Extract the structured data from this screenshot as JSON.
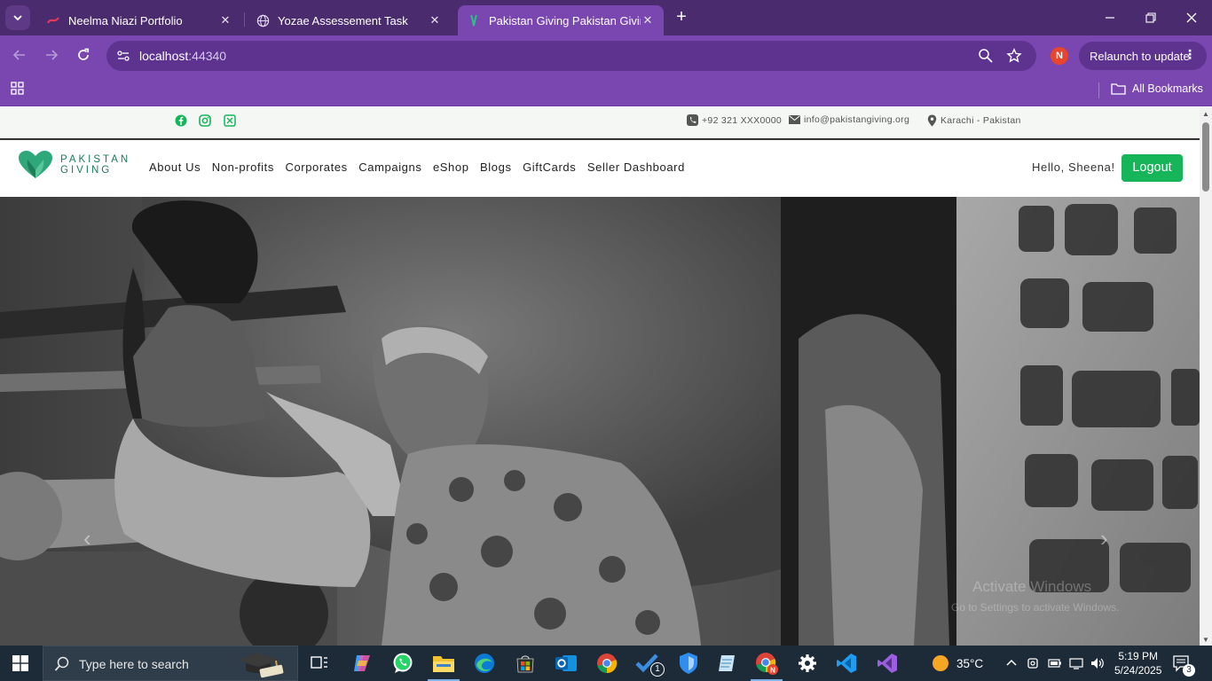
{
  "browser": {
    "tabs": [
      {
        "title": "Neelma Niazi Portfolio",
        "active": false
      },
      {
        "title": "Yozae Assessement Task",
        "active": false
      },
      {
        "title": "Pakistan Giving Pakistan Giving",
        "active": true
      }
    ],
    "url_host": "localhost",
    "url_port": ":44340",
    "profile_initial": "N",
    "relaunch_label": "Relaunch to update",
    "all_bookmarks_label": "All Bookmarks"
  },
  "site": {
    "topbar": {
      "phone": "+92 321 XXX0000",
      "email": "info@pakistangiving.org",
      "location": "Karachi - Pakistan"
    },
    "logo": {
      "line1": "PAKISTAN",
      "line2": "GIVING"
    },
    "menu": [
      "About Us",
      "Non-profits",
      "Corporates",
      "Campaigns",
      "eShop",
      "Blogs",
      "GiftCards",
      "Seller Dashboard"
    ],
    "greeting": "Hello, Sheena!",
    "logout_label": "Logout",
    "hero": {
      "prev_arrow": "‹",
      "next_arrow": "›",
      "watermark_title": "Activate Windows",
      "watermark_sub": "Go to Settings to activate Windows."
    }
  },
  "taskbar": {
    "search_placeholder": "Type here to search",
    "weather_temp": "35°C",
    "time": "5:19 PM",
    "date": "5/24/2025",
    "notification_count": "3",
    "badge_count": "1"
  },
  "colors": {
    "browser_dark": "#4a2b6e",
    "browser_purple": "#7a46b0",
    "brand_green": "#16b55a",
    "taskbar": "#1d2a38"
  }
}
